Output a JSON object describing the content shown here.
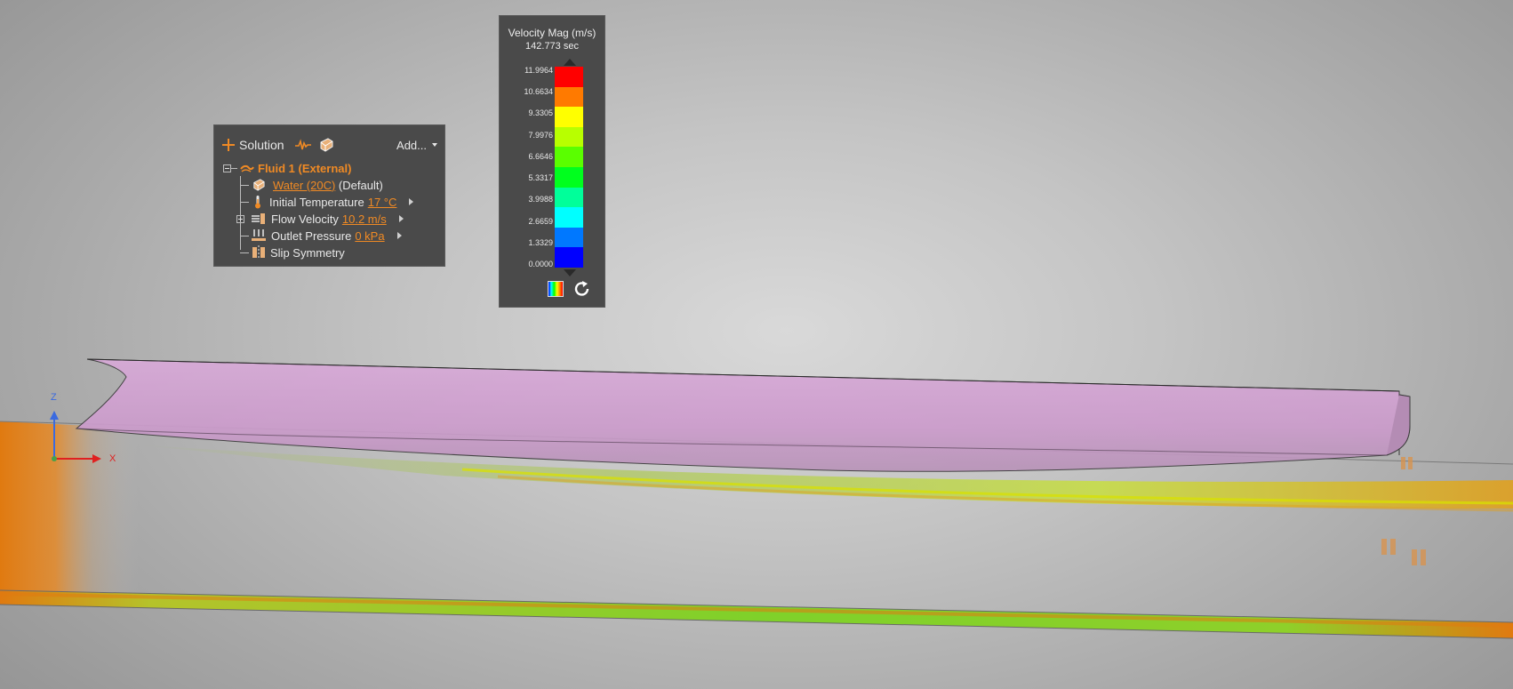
{
  "simulation_tree": {
    "header": {
      "solution_label": "Solution",
      "add_label": "Add..."
    },
    "items": [
      {
        "label": "Fluid 1 (External)"
      },
      {
        "link": "Water (20C)",
        "suffix": " (Default)"
      },
      {
        "label": "Initial Temperature",
        "value": "17 °C"
      },
      {
        "label": "Flow Velocity",
        "value": "10.2 m/s"
      },
      {
        "label": "Outlet Pressure",
        "value": "0 kPa"
      },
      {
        "label": "Slip Symmetry"
      }
    ]
  },
  "legend": {
    "title": "Velocity Mag (m/s)",
    "time": "142.773 sec",
    "ticks": [
      "11.9964",
      "10.6634",
      "9.3305",
      "7.9976",
      "6.6646",
      "5.3317",
      "3.9988",
      "2.6659",
      "1.3329",
      "0.0000"
    ],
    "colors": [
      "#ff0000",
      "#ff7a00",
      "#ffff00",
      "#b8ff00",
      "#5aff00",
      "#00ff1e",
      "#00ff9a",
      "#00ffff",
      "#0078ff",
      "#0000ff"
    ]
  },
  "triad": {
    "z_label": "Z",
    "x_label": "X"
  },
  "colors": {
    "accent": "#f08a24",
    "panel_bg": "#4a4a4a",
    "hull": "#d4a4d4"
  }
}
